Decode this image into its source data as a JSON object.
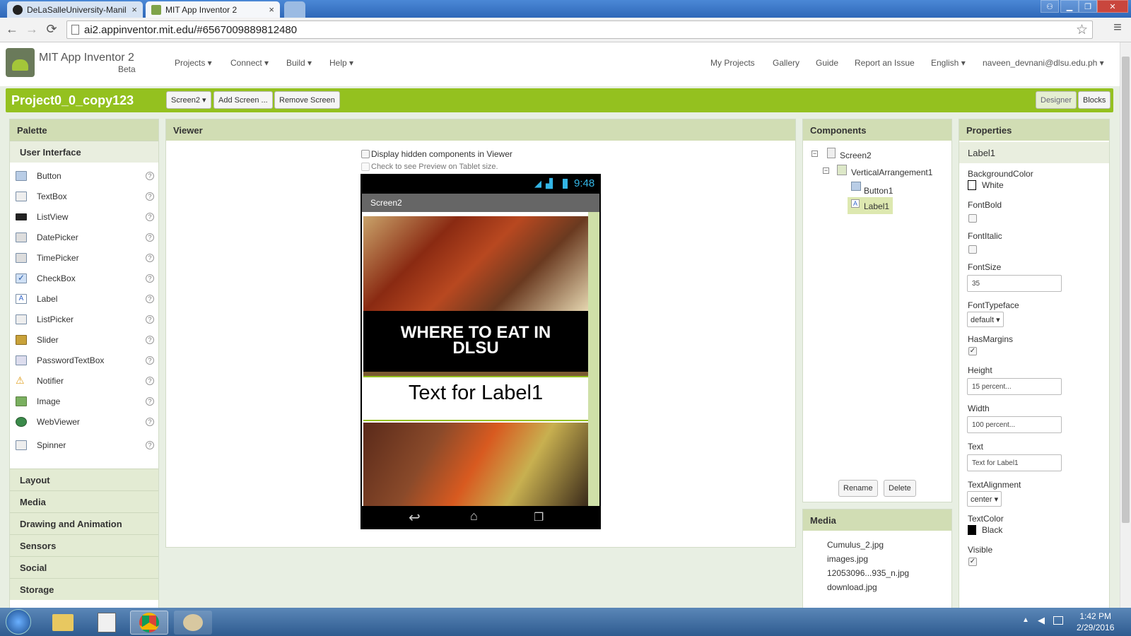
{
  "browser": {
    "tabs": [
      {
        "title": "DeLaSalleUniversity-Manil",
        "close": "×"
      },
      {
        "title": "MIT App Inventor 2",
        "close": "×"
      }
    ],
    "url": "ai2.appinventor.mit.edu/#6567009889812480",
    "back": "←",
    "forward": "→",
    "reload": "⟳",
    "star": "☆",
    "menu": "≡"
  },
  "app": {
    "logo_title": "MIT App Inventor 2",
    "logo_subtitle": "Beta",
    "menus": [
      "Projects ▾",
      "Connect ▾",
      "Build ▾",
      "Help ▾"
    ],
    "right_links": [
      "My Projects",
      "Gallery",
      "Guide",
      "Report an Issue",
      "English ▾",
      "naveen_devnani@dlsu.edu.ph ▾"
    ]
  },
  "project": {
    "name": "Project0_0_copy123",
    "screen_select": "Screen2 ▾",
    "add_screen": "Add Screen ...",
    "remove_screen": "Remove Screen",
    "designer": "Designer",
    "blocks": "Blocks"
  },
  "palette": {
    "title": "Palette",
    "open_category": "User Interface",
    "items": [
      "Button",
      "TextBox",
      "ListView",
      "DatePicker",
      "TimePicker",
      "CheckBox",
      "Label",
      "ListPicker",
      "Slider",
      "PasswordTextBox",
      "Notifier",
      "Image",
      "WebViewer",
      "Spinner"
    ],
    "help": "?",
    "categories": [
      "Layout",
      "Media",
      "Drawing and Animation",
      "Sensors",
      "Social",
      "Storage"
    ]
  },
  "viewer": {
    "title": "Viewer",
    "hidden_label": "Display hidden components in Viewer",
    "tablet_label": "Check to see Preview on Tablet size.",
    "phone": {
      "time": "9:48",
      "screen_title": "Screen2",
      "banner_text": "WHERE TO EAT IN DLSU",
      "label_text": "Text for Label1"
    }
  },
  "components": {
    "title": "Components",
    "tree": [
      "Screen2",
      "VerticalArrangement1",
      "Button1",
      "Label1"
    ],
    "rename": "Rename",
    "delete": "Delete"
  },
  "media": {
    "title": "Media",
    "files": [
      "Cumulus_2.jpg",
      "images.jpg",
      "12053096...935_n.jpg",
      "download.jpg"
    ]
  },
  "properties": {
    "title": "Properties",
    "component": "Label1",
    "background_color_label": "BackgroundColor",
    "background_color_value": "White",
    "fontbold_label": "FontBold",
    "fontitalic_label": "FontItalic",
    "fontsize_label": "FontSize",
    "fontsize_value": "35",
    "fonttypeface_label": "FontTypeface",
    "fonttypeface_value": "default ▾",
    "hasmargins_label": "HasMargins",
    "height_label": "Height",
    "height_value": "15 percent...",
    "width_label": "Width",
    "width_value": "100 percent...",
    "text_label": "Text",
    "text_value": "Text for Label1",
    "textalignment_label": "TextAlignment",
    "textalignment_value": "center ▾",
    "textcolor_label": "TextColor",
    "textcolor_value": "Black",
    "visible_label": "Visible"
  },
  "taskbar": {
    "time": "1:42 PM",
    "date": "2/29/2016"
  },
  "colors": {
    "accent_green": "#94c11f",
    "panel_header": "#d1ddb4",
    "page_bg": "#e8efe3"
  }
}
